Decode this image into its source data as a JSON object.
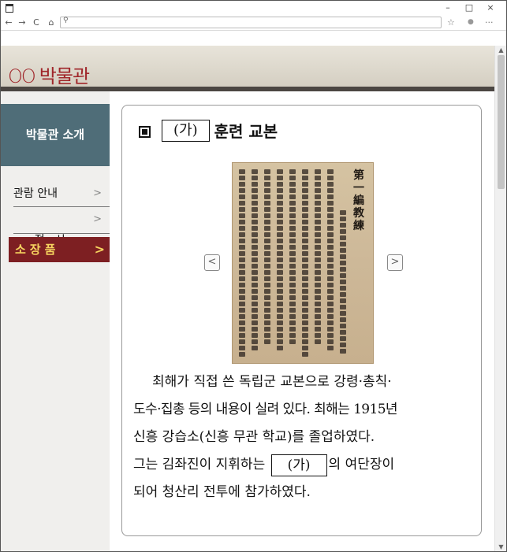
{
  "browser": {
    "controls": {
      "minimize": "–",
      "maximize": "□",
      "close": "×"
    },
    "nav": {
      "back": "←",
      "forward": "→",
      "reload": "C",
      "home": "⌂",
      "search_icon": "⚲"
    },
    "right_icons": {
      "favorites": "☆",
      "profile": "●",
      "menu": "···"
    }
  },
  "header": {
    "logo_circles": "OO",
    "logo_text": "박물관"
  },
  "sidebar": {
    "heading": "박물관 소개",
    "items": [
      {
        "label": "관람 안내",
        "arrow": ">"
      },
      {
        "label": "전   시",
        "arrow": ">"
      }
    ],
    "active": {
      "label": "소장품",
      "arrow": ">"
    }
  },
  "main": {
    "title_blank": "(가)",
    "title_text": "훈련 교본",
    "book_title": "第一編 教練",
    "carousel": {
      "prev": "<",
      "next": ">"
    },
    "paragraph": {
      "line1": "최해가 직접 쓴 독립군 교본으로 강령·총칙·",
      "line2": "도수·집총 등의 내용이 실려 있다. 최해는 1915년",
      "line3": "신흥 강습소(신흥 무관 학교)를 졸업하였다.",
      "line4_pre": "그는 김좌진이 지휘하는",
      "line4_blank": "(가)",
      "line4_post": "의 여단장이",
      "line5": "되어 청산리 전투에 참가하였다."
    }
  },
  "colors": {
    "sidebar_head_bg": "#4f6d78",
    "active_bg": "#7d1f22",
    "active_text": "#f6d35f",
    "logo": "#a0262a"
  }
}
